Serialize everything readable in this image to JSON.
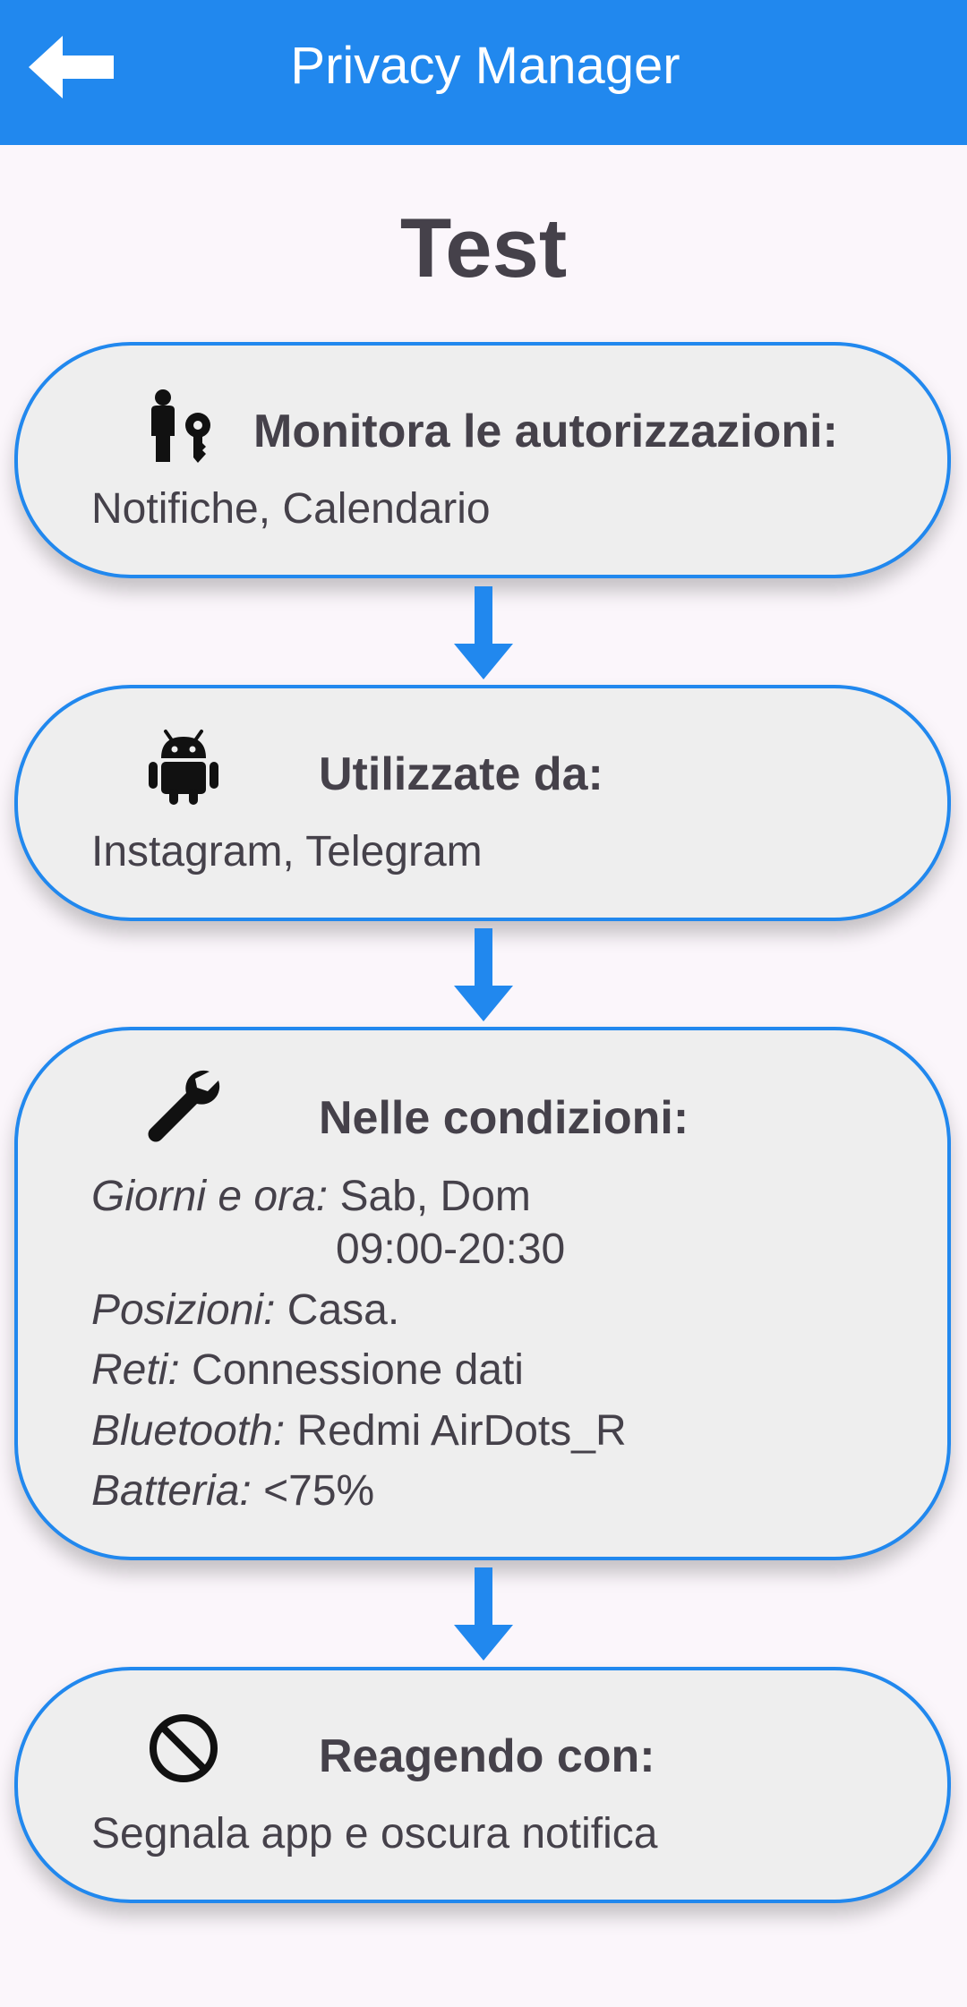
{
  "header": {
    "title": "Privacy Manager",
    "back_icon": "arrow-back-icon"
  },
  "rule": {
    "name": "Test"
  },
  "permissions": {
    "icon": "person-key-icon",
    "heading": "Monitora le autorizzazioni:",
    "value": "Notifiche, Calendario"
  },
  "apps": {
    "icon": "android-icon",
    "heading": "Utilizzate da:",
    "value": "Instagram, Telegram"
  },
  "conditions": {
    "icon": "wrench-icon",
    "heading": "Nelle condizioni:",
    "days_label": "Giorni e ora:",
    "days_value": "Sab, Dom",
    "time_value": "09:00-20:30",
    "locations_label": "Posizioni:",
    "locations_value": "Casa.",
    "networks_label": "Reti:",
    "networks_value": "Connessione dati",
    "bluetooth_label": "Bluetooth:",
    "bluetooth_value": "Redmi AirDots_R",
    "battery_label": "Batteria:",
    "battery_value": "<75%"
  },
  "reaction": {
    "icon": "block-icon",
    "heading": "Reagendo con:",
    "value": "Segnala app e oscura notifica"
  },
  "colors": {
    "accent": "#2188ee",
    "card_bg": "#eeeeee",
    "page_bg": "#fbf6fb",
    "text": "#45414a"
  }
}
